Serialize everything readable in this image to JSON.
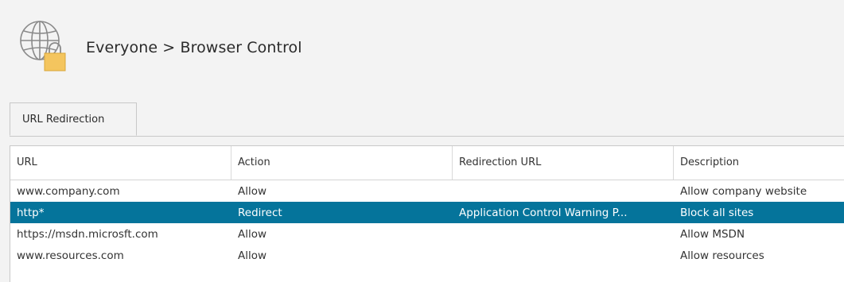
{
  "header": {
    "title": "Everyone > Browser Control",
    "icon": "globe-lock-icon"
  },
  "tabs": [
    {
      "label": "URL Redirection",
      "active": true
    }
  ],
  "table": {
    "columns": [
      "URL",
      "Action",
      "Redirection URL",
      "Description"
    ],
    "rows": [
      {
        "url": "www.company.com",
        "action": "Allow",
        "redirection_url": "",
        "description": "Allow company website",
        "selected": false
      },
      {
        "url": "http*",
        "action": "Redirect",
        "redirection_url": "Application Control Warning P...",
        "description": "Block all sites",
        "selected": true
      },
      {
        "url": "https://msdn.microsft.com",
        "action": "Allow",
        "redirection_url": "",
        "description": "Allow MSDN",
        "selected": false
      },
      {
        "url": "www.resources.com",
        "action": "Allow",
        "redirection_url": "",
        "description": "Allow resources",
        "selected": false
      }
    ]
  },
  "colors": {
    "selection": "#05749b",
    "lock": "#f4c55e"
  }
}
